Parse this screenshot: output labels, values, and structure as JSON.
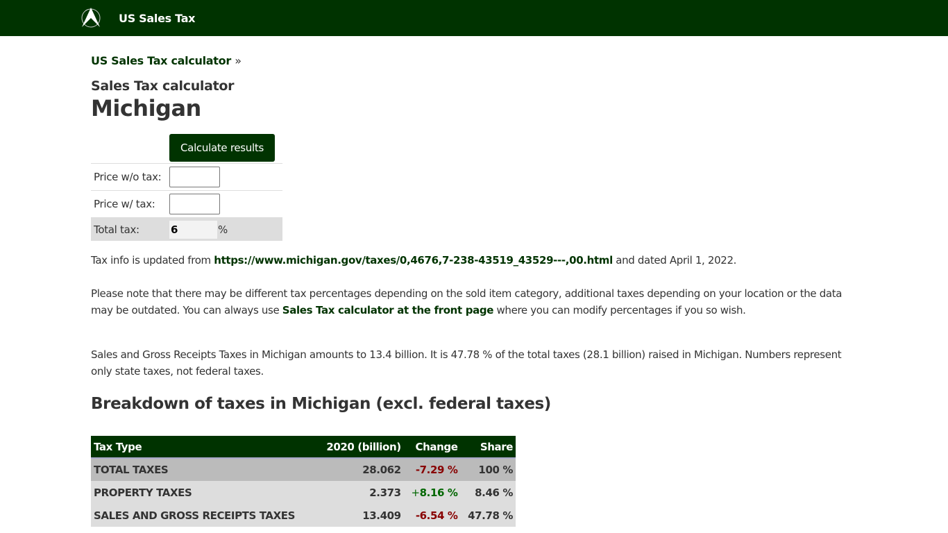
{
  "header": {
    "brand": "US Sales Tax",
    "logo_icon": "compass-logo-icon"
  },
  "breadcrumb": {
    "link": "US Sales Tax calculator",
    "separator": "»"
  },
  "subtitle": "Sales Tax calculator",
  "title": "Michigan",
  "calculator": {
    "button_label": "Calculate results",
    "price_wo_tax_label": "Price w/o tax:",
    "price_wo_tax_value": "",
    "price_w_tax_label": "Price w/ tax:",
    "price_w_tax_value": "",
    "total_tax_label": "Total tax:",
    "total_tax_value": "6",
    "percent_sign": "%"
  },
  "info": {
    "p1_prefix": "Tax info is updated from ",
    "p1_link": "https://www.michigan.gov/taxes/0,4676,7-238-43519_43529---,00.html",
    "p1_suffix": " and dated April 1, 2022.",
    "p2_prefix": "Please note that there may be different tax percentages depending on the sold item category, additional taxes depending on your location or the data may be outdated. You can always use ",
    "p2_link": "Sales Tax calculator at the front page",
    "p2_suffix": " where you can modify percentages if you so wish.",
    "p3": "Sales and Gross Receipts Taxes in Michigan amounts to 13.4 billion. It is 47.78 % of the total taxes (28.1 billion) raised in Michigan. Numbers represent only state taxes, not federal taxes."
  },
  "breakdown": {
    "heading": "Breakdown of taxes in Michigan (excl. federal taxes)",
    "columns": [
      "Tax Type",
      "2020 (billion)",
      "Change",
      "Share"
    ],
    "rows": [
      {
        "type": "TOTAL TAXES",
        "value": "28.062",
        "change": "-7.29 %",
        "share": "100 %"
      },
      {
        "type": "PROPERTY TAXES",
        "value": "2.373",
        "change_sign": "+",
        "change": "8.16 %",
        "share": "8.46 %"
      },
      {
        "type": "SALES AND GROSS RECEIPTS TAXES",
        "value": "13.409",
        "change": "-6.54 %",
        "share": "47.78 %"
      }
    ]
  }
}
